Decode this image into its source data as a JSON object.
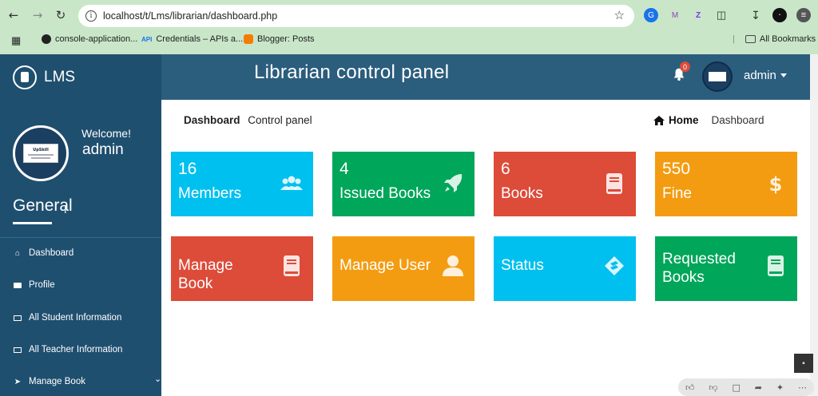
{
  "browser": {
    "url": "localhost/t/Lms/librarian/dashboard.php",
    "bookmarks": [
      {
        "label": "console-application..."
      },
      {
        "label": "Credentials – APIs a..."
      },
      {
        "label": "Blogger: Posts"
      }
    ],
    "all_bookmarks": "All Bookmarks"
  },
  "header": {
    "logo": "LMS",
    "title": "Librarian control panel",
    "notification_count": "0",
    "user": "admin"
  },
  "sidebar": {
    "welcome": "Welcome!",
    "user": "admin",
    "section": "General",
    "items": [
      {
        "label": "Dashboard"
      },
      {
        "label": "Profile"
      },
      {
        "label": "All Student Information"
      },
      {
        "label": "All Teacher Information"
      },
      {
        "label": "Manage Book"
      }
    ]
  },
  "breadcrumb": {
    "title": "Dashboard",
    "subtitle": "Control panel",
    "home": "Home",
    "current": "Dashboard"
  },
  "tiles": [
    {
      "number": "16",
      "label": "Members",
      "color": "#00c0ef",
      "icon": "users-icon"
    },
    {
      "number": "4",
      "label": "Issued Books",
      "color": "#00a65a",
      "icon": "rocket-icon"
    },
    {
      "number": "6",
      "label": "Books",
      "color": "#dd4b39",
      "icon": "book-icon"
    },
    {
      "number": "550",
      "label": "Fine",
      "color": "#f39c12",
      "icon": "dollar-icon"
    },
    {
      "line1": "Manage",
      "line2": "Book",
      "color": "#dd4b39",
      "icon": "book-icon"
    },
    {
      "label": "Manage User",
      "color": "#f39c12",
      "icon": "user-icon"
    },
    {
      "label": "Status",
      "color": "#00c0ef",
      "icon": "layers-icon"
    },
    {
      "line1": "Requested",
      "line2": "Books",
      "color": "#00a65a",
      "icon": "book-icon"
    }
  ]
}
